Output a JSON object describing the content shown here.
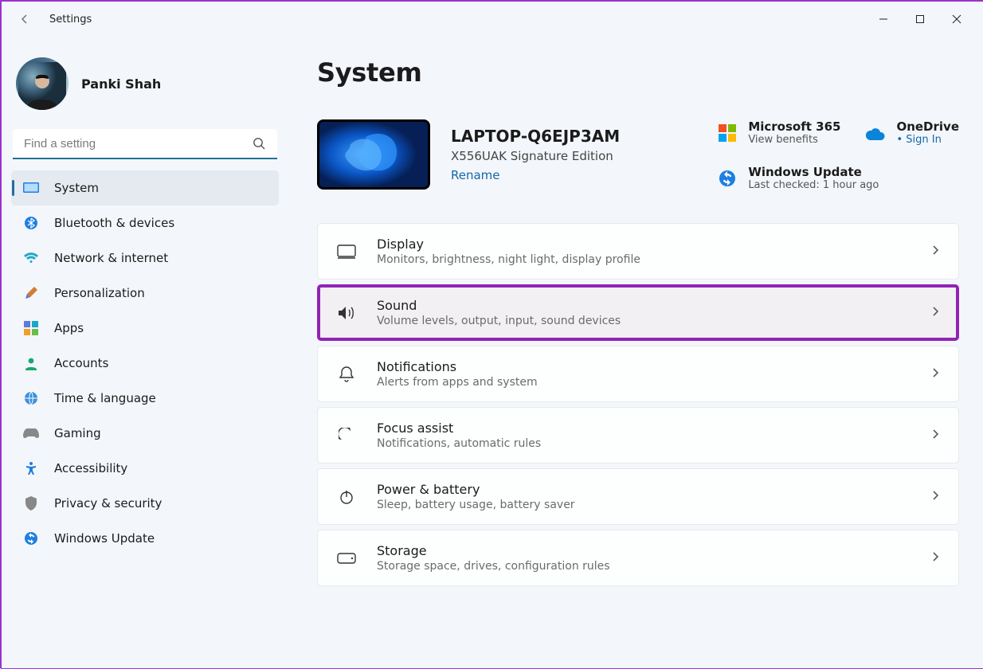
{
  "window": {
    "title": "Settings"
  },
  "profile": {
    "name": "Panki Shah"
  },
  "search": {
    "placeholder": "Find a setting"
  },
  "sidebar": {
    "items": [
      {
        "label": "System"
      },
      {
        "label": "Bluetooth & devices"
      },
      {
        "label": "Network & internet"
      },
      {
        "label": "Personalization"
      },
      {
        "label": "Apps"
      },
      {
        "label": "Accounts"
      },
      {
        "label": "Time & language"
      },
      {
        "label": "Gaming"
      },
      {
        "label": "Accessibility"
      },
      {
        "label": "Privacy & security"
      },
      {
        "label": "Windows Update"
      }
    ]
  },
  "page": {
    "heading": "System"
  },
  "device": {
    "name": "LAPTOP-Q6EJP3AM",
    "model": "X556UAK Signature Edition",
    "rename_label": "Rename"
  },
  "quicklinks": {
    "ms365": {
      "title": "Microsoft 365",
      "sub": "View benefits"
    },
    "onedrive": {
      "title": "OneDrive",
      "sub": "Sign In"
    },
    "winupdate": {
      "title": "Windows Update",
      "sub": "Last checked: 1 hour ago"
    }
  },
  "cards": [
    {
      "title": "Display",
      "sub": "Monitors, brightness, night light, display profile"
    },
    {
      "title": "Sound",
      "sub": "Volume levels, output, input, sound devices"
    },
    {
      "title": "Notifications",
      "sub": "Alerts from apps and system"
    },
    {
      "title": "Focus assist",
      "sub": "Notifications, automatic rules"
    },
    {
      "title": "Power & battery",
      "sub": "Sleep, battery usage, battery saver"
    },
    {
      "title": "Storage",
      "sub": "Storage space, drives, configuration rules"
    }
  ]
}
